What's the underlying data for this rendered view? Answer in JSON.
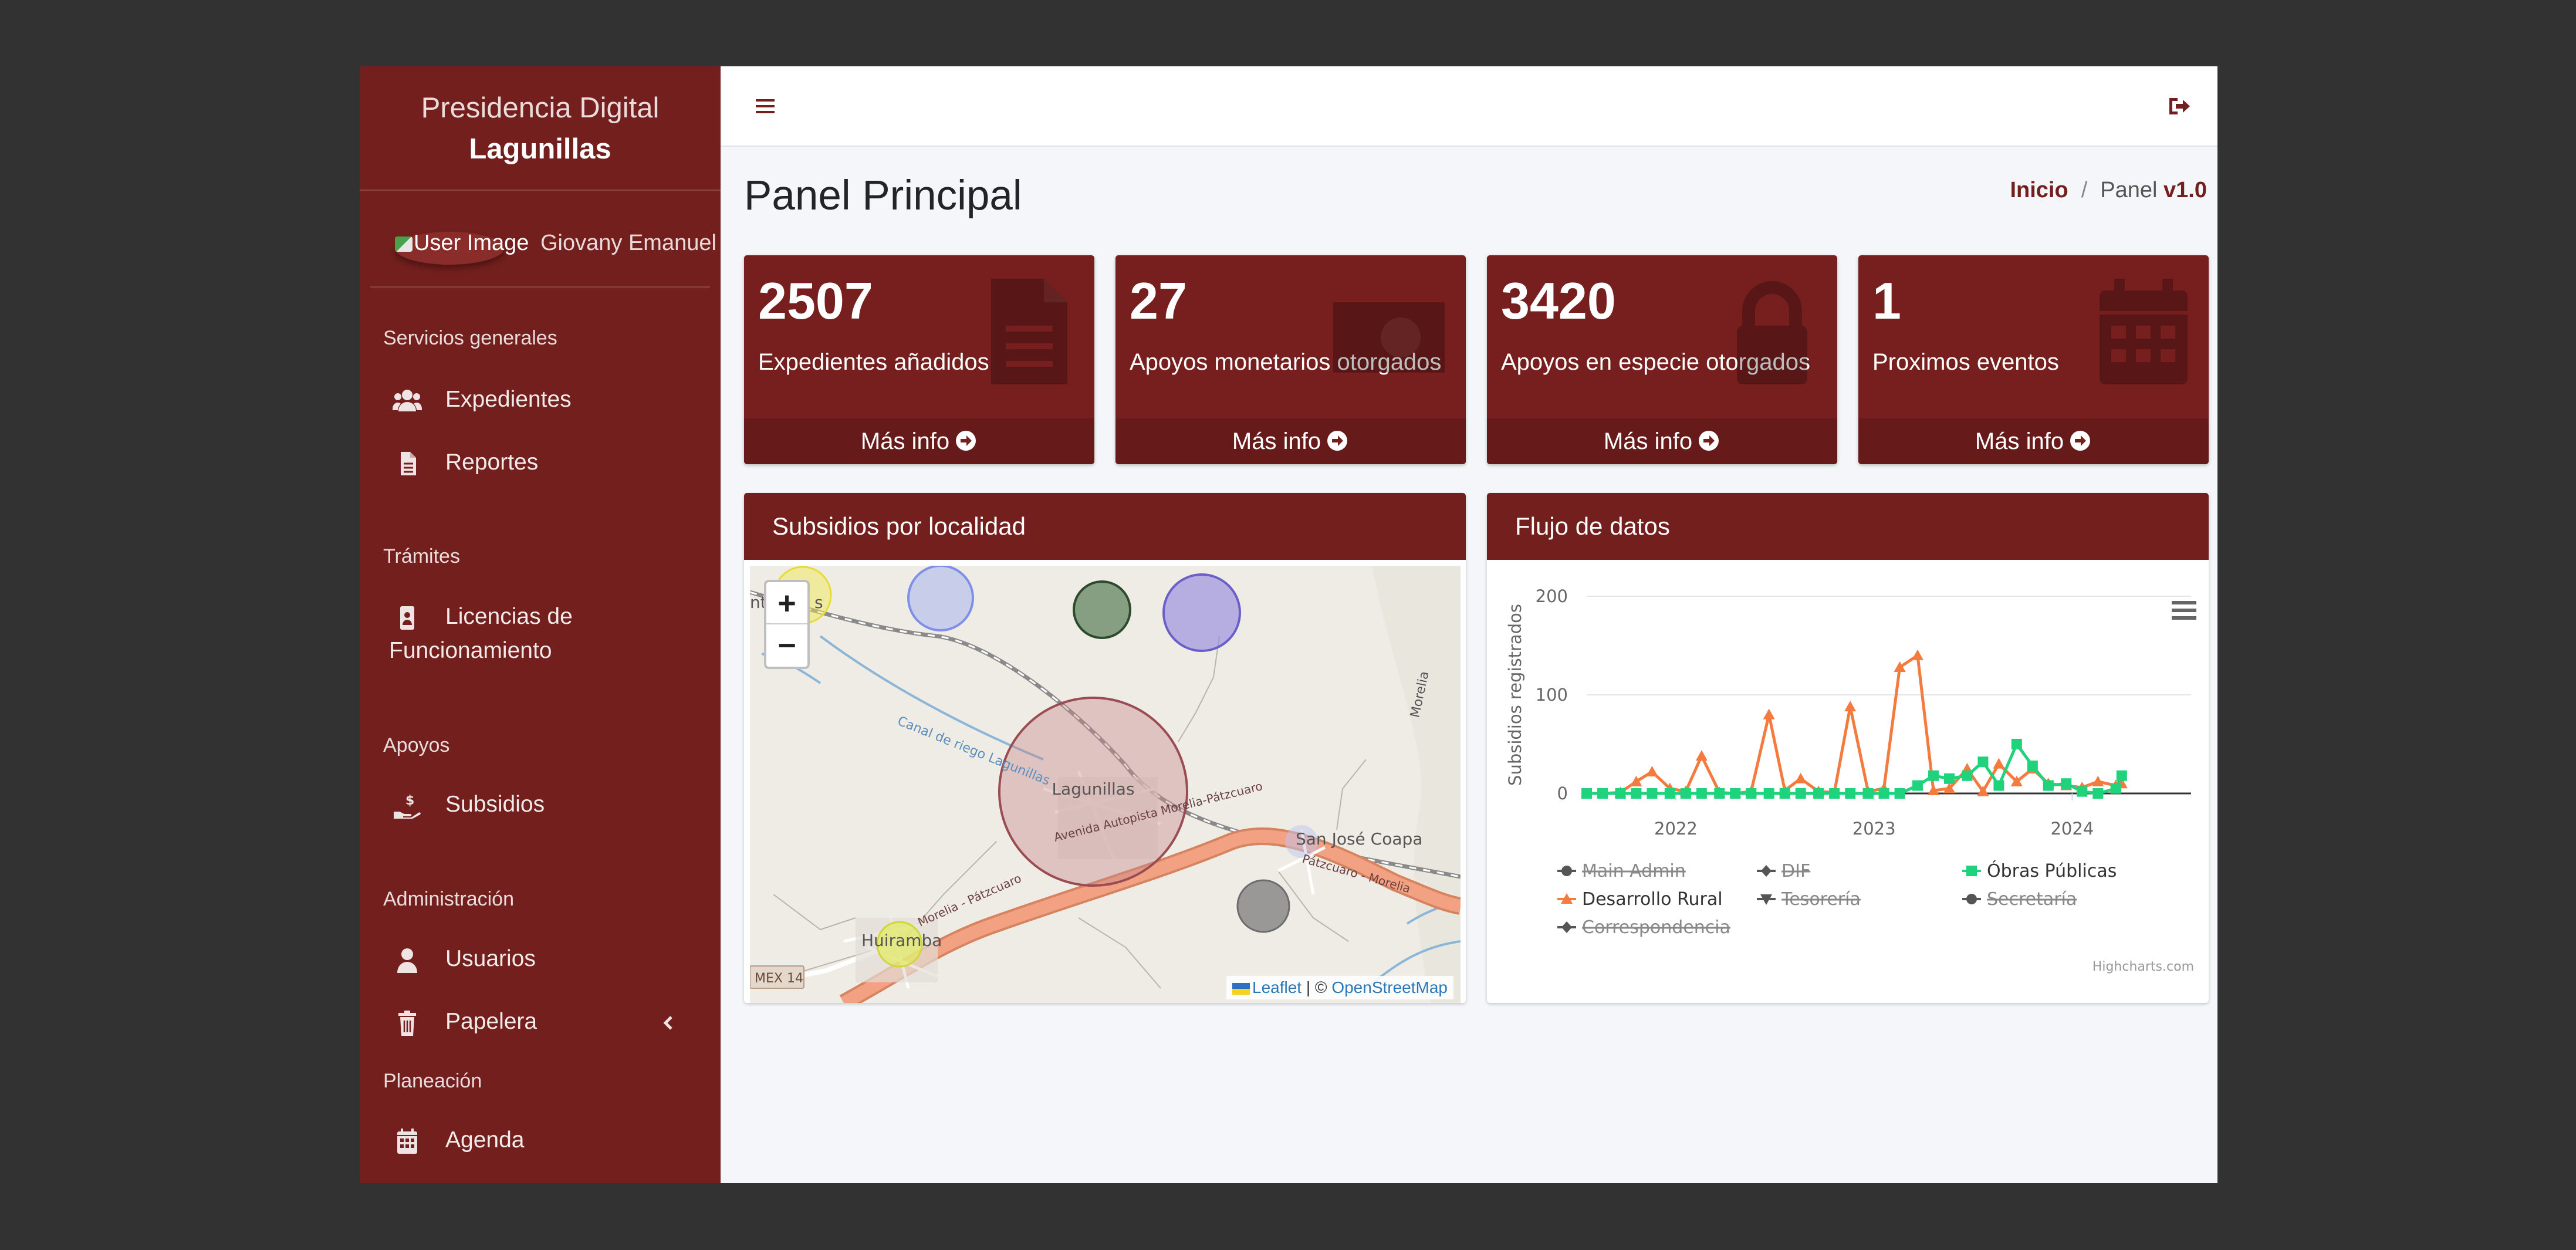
{
  "sidebar": {
    "brand_line1": "Presidencia Digital",
    "brand_line2": "Lagunillas",
    "user_image_alt": "User Image",
    "user_name": "Giovany Emanuel",
    "sections": {
      "servicios": "Servicios generales",
      "tramites": "Trámites",
      "apoyos": "Apoyos",
      "administracion": "Administración",
      "planeacion": "Planeación"
    },
    "items": {
      "expedientes": "Expedientes",
      "reportes": "Reportes",
      "licencias_1": "Licencias de",
      "licencias_2": "Funcionamiento",
      "subsidios": "Subsidios",
      "usuarios": "Usuarios",
      "papelera": "Papelera",
      "agenda": "Agenda"
    }
  },
  "header": {
    "page_title": "Panel Principal",
    "breadcrumb_home": "Inicio",
    "breadcrumb_sep": "/",
    "breadcrumb_current": "Panel",
    "version": "v1.0"
  },
  "stats": [
    {
      "value": "2507",
      "caption": "Expedientes añadidos",
      "more": "Más info",
      "icon": "file-icon"
    },
    {
      "value": "27",
      "caption": "Apoyos monetarios otorgados",
      "more": "Más info",
      "icon": "money-icon"
    },
    {
      "value": "3420",
      "caption": "Apoyos en especie otorgados",
      "more": "Más info",
      "icon": "lock-icon"
    },
    {
      "value": "1",
      "caption": "Proximos eventos",
      "more": "Más info",
      "icon": "calendar-icon"
    }
  ],
  "map_card": {
    "title": "Subsidios por localidad",
    "zoom_in": "+",
    "zoom_out": "−",
    "labels": {
      "lagunillas": "Lagunillas",
      "san_jose": "San José Coapa",
      "huiramba": "Huiramba",
      "canal": "Canal de riego Lagunillas",
      "autopista": "Avenida Autopista Morelia-Pátzcuaro",
      "patzcuaro_morelia": "Pátzcuaro - Morelia",
      "morelia_patzcuaro": "Morelia - Pátzcuaro",
      "morelia": "Morelia",
      "mex14": "MEX 14",
      "partial_left": "nt",
      "partial_s": "s"
    },
    "attribution_leaflet": "Leaflet",
    "attribution_sep": " | © ",
    "attribution_osm": "OpenStreetMap"
  },
  "chart_card": {
    "title": "Flujo de datos",
    "credit": "Highcharts.com"
  },
  "chart_data": {
    "type": "line",
    "ylabel": "Subsidios registrados",
    "ylim": [
      0,
      200
    ],
    "yticks": [
      0,
      100,
      200
    ],
    "xticks": [
      "2022",
      "2023",
      "2024"
    ],
    "legend": [
      {
        "name": "Main Admin",
        "hidden": true,
        "marker": "circle"
      },
      {
        "name": "DIF",
        "hidden": true,
        "marker": "diamond"
      },
      {
        "name": "Óbras Públicas",
        "hidden": false,
        "marker": "square"
      },
      {
        "name": "Desarrollo Rural",
        "hidden": false,
        "marker": "triangle"
      },
      {
        "name": "Tesorería",
        "hidden": true,
        "marker": "triangle-down"
      },
      {
        "name": "Secretaría",
        "hidden": true,
        "marker": "circle"
      },
      {
        "name": "Correspondencia",
        "hidden": true,
        "marker": "diamond"
      }
    ],
    "series": [
      {
        "name": "Desarrollo Rural",
        "color": "#f47a3e",
        "x": [
          2021.55,
          2021.63,
          2021.72,
          2021.8,
          2021.88,
          2021.97,
          2022.05,
          2022.13,
          2022.22,
          2022.3,
          2022.38,
          2022.47,
          2022.55,
          2022.63,
          2022.72,
          2022.8,
          2022.88,
          2022.97,
          2023.05,
          2023.13,
          2023.22,
          2023.3,
          2023.38,
          2023.47,
          2023.55,
          2023.63,
          2023.72,
          2023.8,
          2023.88,
          2023.97,
          2024.05,
          2024.13,
          2024.22,
          2024.25
        ],
        "values": [
          0,
          0,
          1,
          12,
          22,
          5,
          2,
          38,
          1,
          0,
          2,
          80,
          3,
          15,
          2,
          1,
          88,
          2,
          5,
          128,
          140,
          3,
          5,
          25,
          2,
          30,
          12,
          25,
          10,
          8,
          6,
          12,
          8,
          10
        ]
      },
      {
        "name": "Óbras Públicas",
        "color": "#1ed37c",
        "x": [
          2021.55,
          2021.63,
          2021.72,
          2021.8,
          2021.88,
          2021.97,
          2022.05,
          2022.13,
          2022.22,
          2022.3,
          2022.38,
          2022.47,
          2022.55,
          2022.63,
          2022.72,
          2022.8,
          2022.88,
          2022.97,
          2023.05,
          2023.13,
          2023.22,
          2023.3,
          2023.38,
          2023.47,
          2023.55,
          2023.63,
          2023.72,
          2023.8,
          2023.88,
          2023.97,
          2024.05,
          2024.13,
          2024.22,
          2024.25
        ],
        "values": [
          0,
          0,
          0,
          0,
          0,
          0,
          0,
          0,
          0,
          0,
          0,
          0,
          0,
          0,
          0,
          0,
          0,
          0,
          0,
          0,
          8,
          18,
          15,
          18,
          32,
          8,
          50,
          28,
          8,
          10,
          2,
          0,
          5,
          18
        ]
      }
    ]
  },
  "colors": {
    "sidebar": "#731f1d",
    "accent": "#761f1e",
    "desarrollo_rural": "#f47a3e",
    "obras_publicas": "#1ed37c",
    "hidden_series": "#555555"
  },
  "icons": {
    "menu": "hamburger-icon",
    "logout": "sign-out-icon"
  }
}
